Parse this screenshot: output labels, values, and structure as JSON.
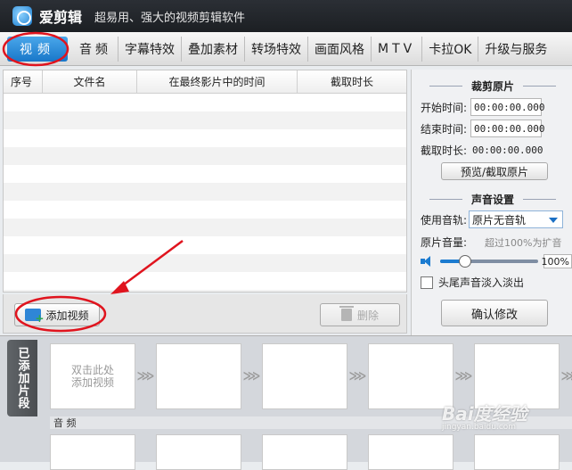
{
  "titlebar": {
    "app_name": "爱剪辑",
    "slogan": "超易用、强大的视频剪辑软件"
  },
  "tabs": [
    {
      "label": "视频"
    },
    {
      "label": "音频"
    },
    {
      "label": "字幕特效"
    },
    {
      "label": "叠加素材"
    },
    {
      "label": "转场特效"
    },
    {
      "label": "画面风格"
    },
    {
      "label": "MTV"
    },
    {
      "label": "卡拉OK"
    },
    {
      "label": "升级与服务"
    }
  ],
  "video_list": {
    "columns": [
      "序号",
      "文件名",
      "在最终影片中的时间",
      "截取时长"
    ],
    "rows": []
  },
  "actions": {
    "add_video": "添加视频",
    "delete": "删除"
  },
  "trim": {
    "title": "裁剪原片",
    "start_label": "开始时间:",
    "start_value": "00:00:00.000",
    "end_label": "结束时间:",
    "end_value": "00:00:00.000",
    "duration_label": "截取时长:",
    "duration_value": "00:00:00.000",
    "preview_button": "预览/截取原片"
  },
  "audio_settings": {
    "title": "声音设置",
    "track_label": "使用音轨:",
    "track_value": "原片无音轨",
    "volume_label": "原片音量:",
    "volume_hint": "超过100%为扩音",
    "volume_value": "100%",
    "volume_fraction": 0.25,
    "fade_label": "头尾声音淡入淡出",
    "confirm_button": "确认修改"
  },
  "timeline": {
    "added_tab": "已添加片段",
    "slot_hint": "双击此处\n添加视频",
    "audio_label": "音  频"
  },
  "watermark": {
    "brand": "Bai度经验",
    "url": "jingyan.baidu.com"
  },
  "colors": {
    "accent": "#1877c9",
    "annotation": "#e0141e"
  }
}
